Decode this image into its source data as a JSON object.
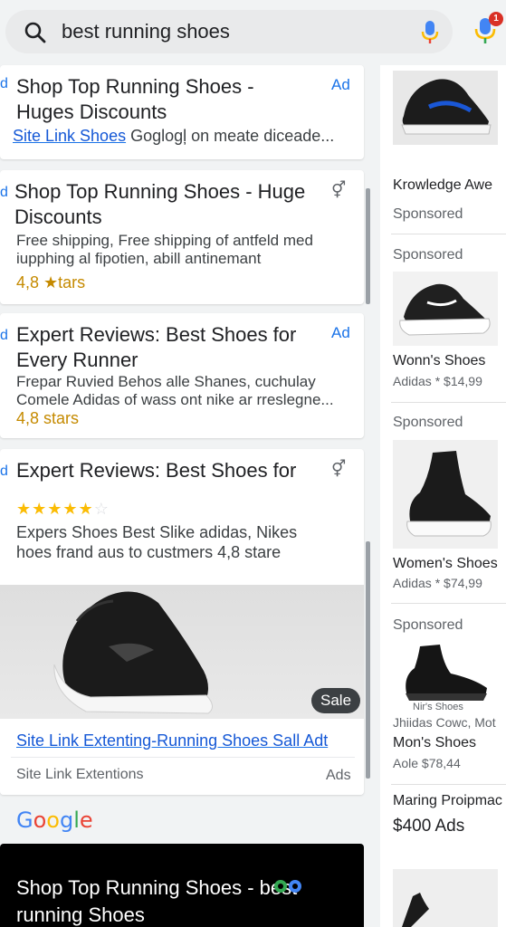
{
  "search": {
    "query": "best running shoes",
    "notification_count": "1"
  },
  "ads": [
    {
      "title": "Shop Top Running Shoes - Huges Discounts",
      "tag": "Ad",
      "sitelink": "Site Link Shoes",
      "desc": "Goglogļ on meate diceade..."
    },
    {
      "title": "Shop Top Running Shoes - Huge Discounts",
      "sym": "⚥",
      "desc1": "Free shipping, Free shipping of antfeld med",
      "desc2": "iupphing al fipotien, abill antinemant",
      "rating": "4,8 ★tars"
    },
    {
      "title": "Expert Reviews: Best Shoes for Every Runner",
      "tag": "Ad",
      "desc1": "Frepar Ruvied Behos alle Shanes, cuchulay",
      "desc2": "Comele Adidas of wass ont nike ar rreslegne...",
      "rating": "4,8 stars"
    },
    {
      "title": "Expert Reviews: Best Shoes for",
      "sym": "⚥",
      "stars": "★★★★★",
      "star_off": "☆",
      "desc1": "Expers Shoes Best Slike adidas, Nikes",
      "desc2": "hoes frand aus to custmers 4,8 stare",
      "sale": "Sale",
      "sitelink": "Site Link Extenting-Running Shoes Sall Adt",
      "footer_left": "Site Link Extentions",
      "footer_right": "Ads"
    }
  ],
  "google_logo": {
    "G": "G",
    "o1": "o",
    "o2": "o",
    "g": "g",
    "l": "l",
    "e": "e"
  },
  "dark_card": {
    "title": "Shop Top Running Shoes - best running Shoes"
  },
  "right_col": {
    "p1": {
      "title": "Krowledge  Awe",
      "sponsored": "Sponsored"
    },
    "p2": {
      "sponsored": "Sponsored",
      "title": "Wonn's Shoes",
      "sub": "Adidas * $14,99"
    },
    "p3": {
      "sponsored": "Sponsored",
      "title": "Women's Shoes",
      "sub": "Adidas * $74,99"
    },
    "p4": {
      "sponsored": "Sponsored",
      "caption": "Nir's Shoes",
      "sub1": "Jhiidas Cowc, Mot",
      "title": "Mon's Shoes",
      "sub2": "Aole $78,44"
    },
    "p5": {
      "title": "Maring Proipmac",
      "price": "$400 Ads"
    }
  },
  "colors": {
    "link": "#1558d6",
    "ad": "#1a73e8",
    "rating": "#c58a00",
    "star": "#fbbc04"
  }
}
